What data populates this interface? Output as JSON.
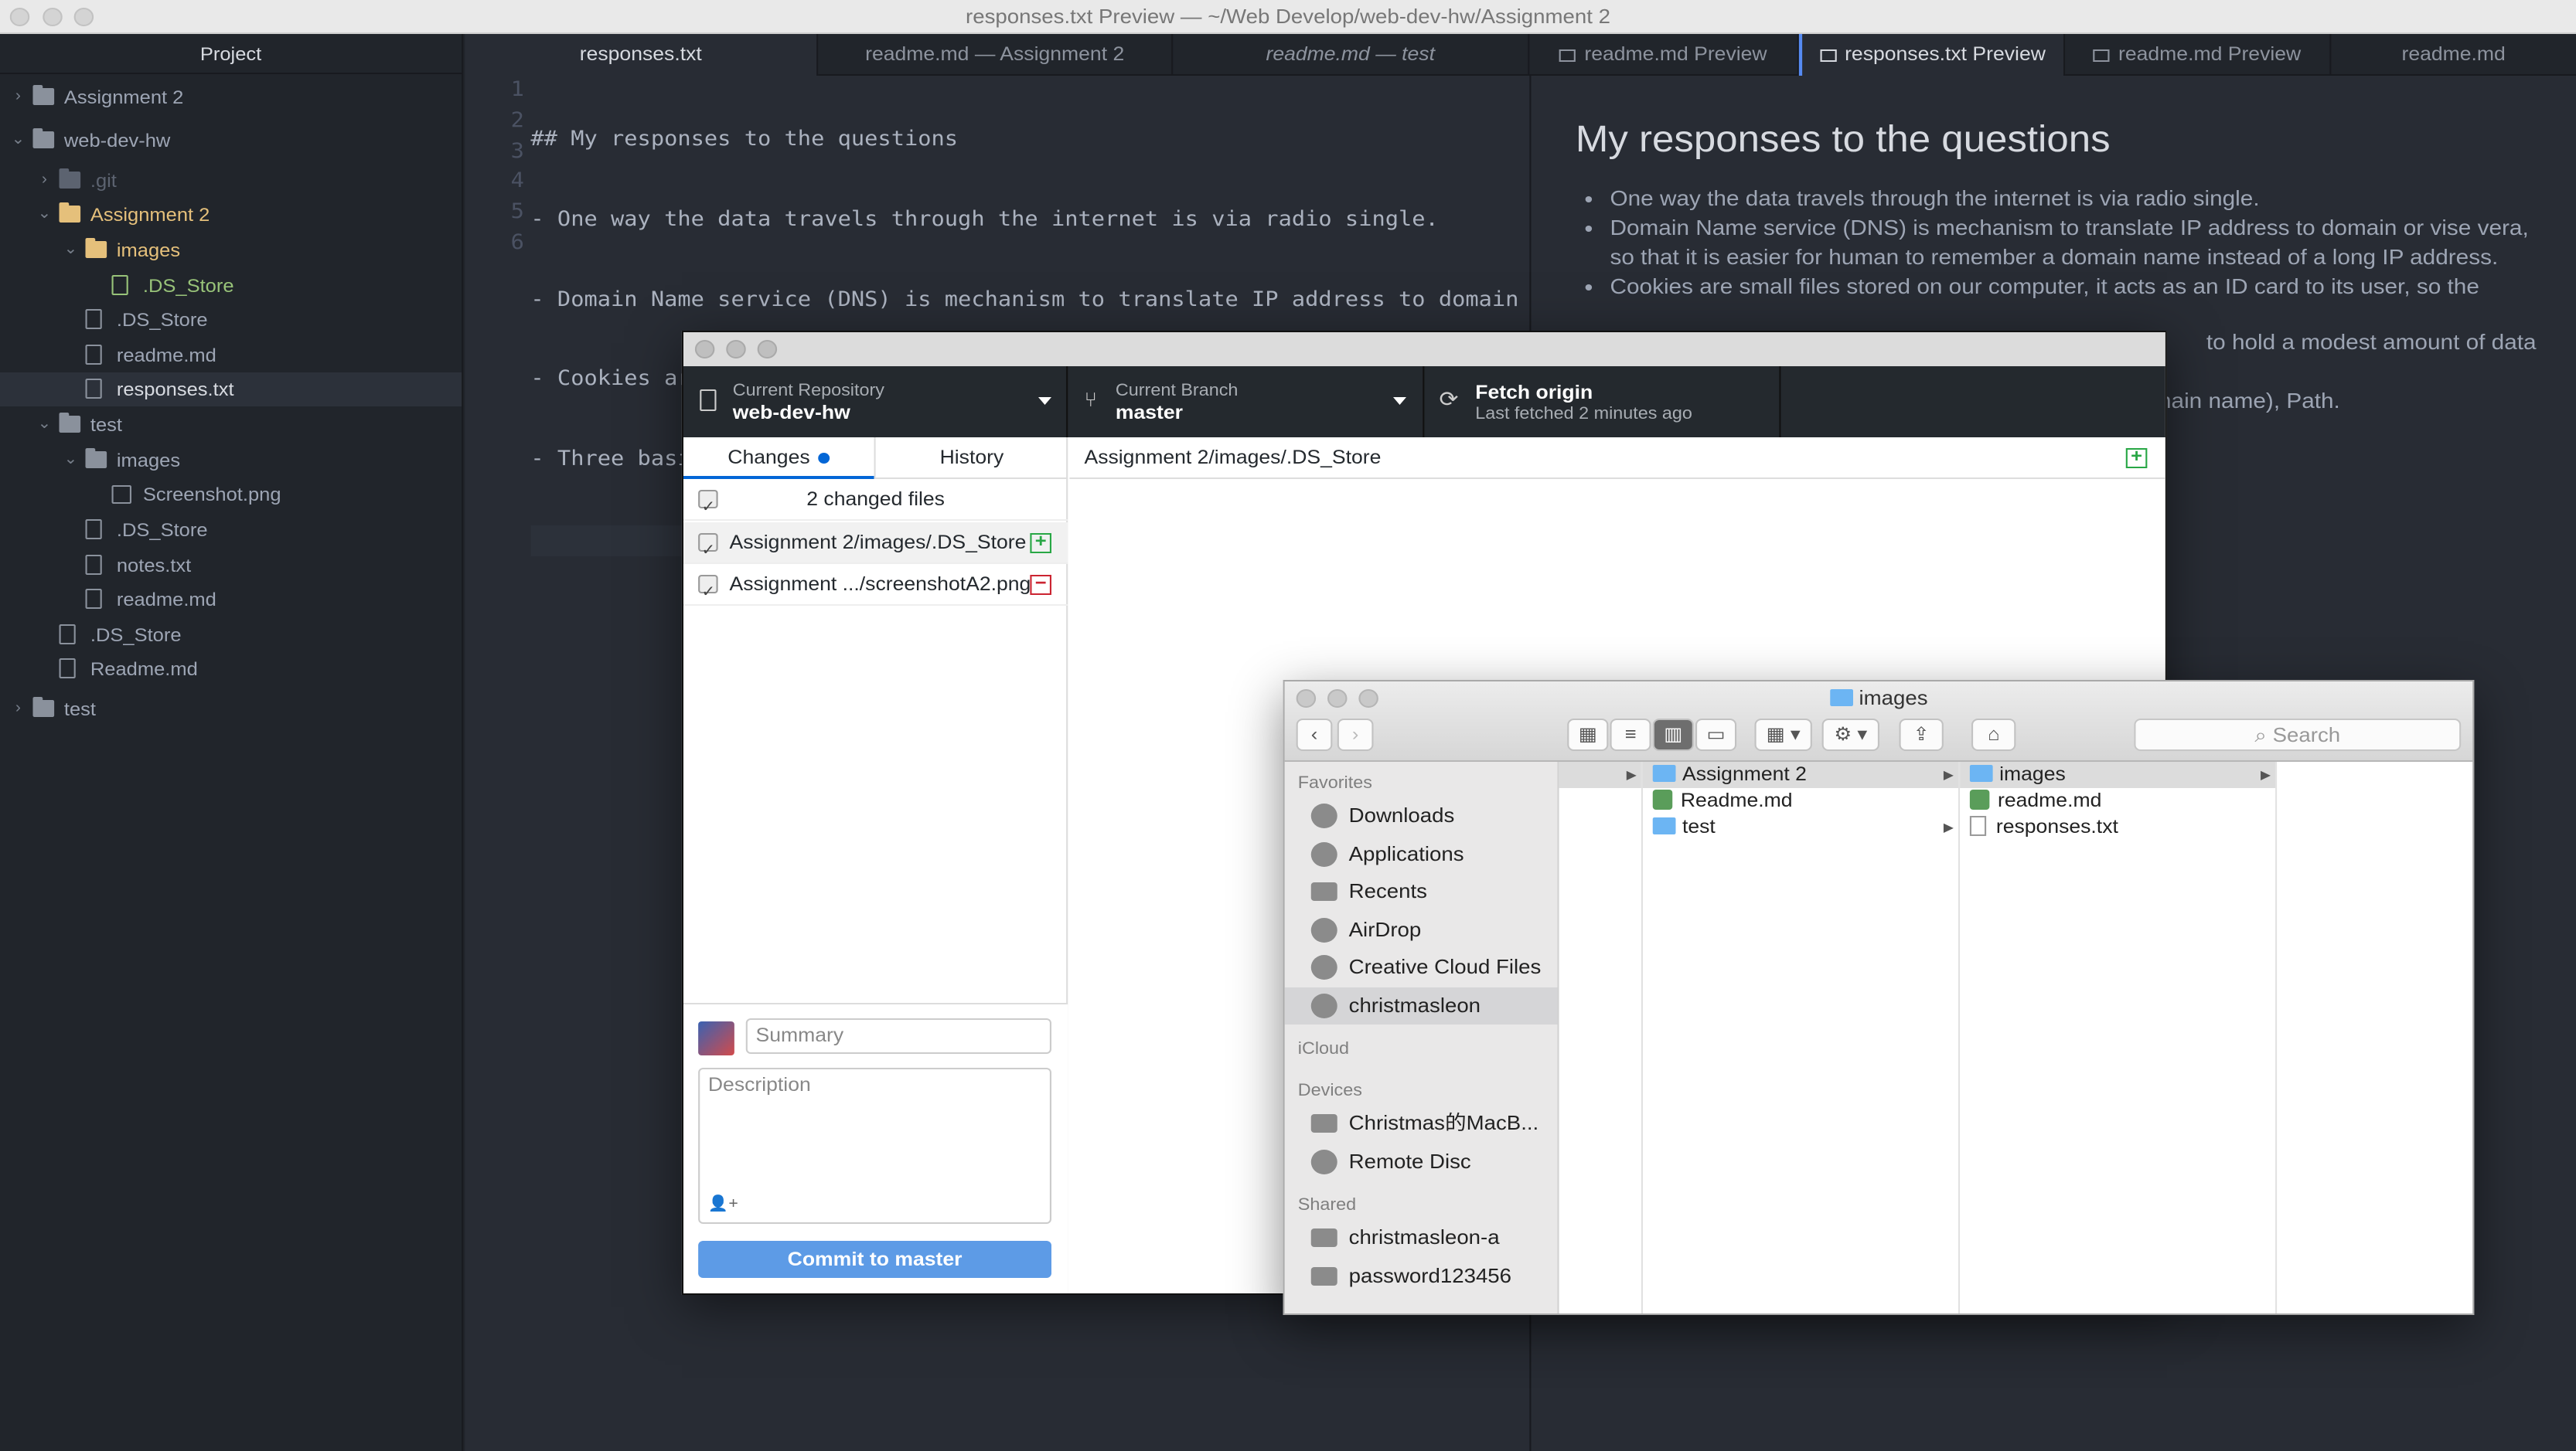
{
  "window": {
    "title": "responses.txt Preview — ~/Web Develop/web-dev-hw/Assignment 2"
  },
  "tree": {
    "header": "Project",
    "rows": [
      {
        "label": "Assignment 2",
        "type": "folder",
        "arrow": "›",
        "color": "#9da5b4"
      },
      {
        "label": "web-dev-hw",
        "type": "folder",
        "arrow": "⌄",
        "color": "#9da5b4"
      },
      {
        "label": ".git",
        "type": "folder",
        "arrow": "›",
        "color": "#5c6370"
      },
      {
        "label": "Assignment 2",
        "type": "folder",
        "arrow": "⌄",
        "color": "#e5c07b"
      },
      {
        "label": "images",
        "type": "folder",
        "arrow": "⌄",
        "color": "#e5c07b"
      },
      {
        "label": ".DS_Store",
        "type": "file",
        "arrow": "",
        "color": "#98c379"
      },
      {
        "label": ".DS_Store",
        "type": "file",
        "arrow": "",
        "color": "#9da5b4"
      },
      {
        "label": "readme.md",
        "type": "file",
        "arrow": "",
        "color": "#9da5b4"
      },
      {
        "label": "responses.txt",
        "type": "file",
        "arrow": "",
        "color": "#d7dae0"
      },
      {
        "label": "test",
        "type": "folder",
        "arrow": "⌄",
        "color": "#9da5b4"
      },
      {
        "label": "images",
        "type": "folder",
        "arrow": "⌄",
        "color": "#9da5b4"
      },
      {
        "label": "Screenshot.png",
        "type": "img",
        "arrow": "",
        "color": "#9da5b4"
      },
      {
        "label": ".DS_Store",
        "type": "file",
        "arrow": "",
        "color": "#9da5b4"
      },
      {
        "label": "notes.txt",
        "type": "file",
        "arrow": "",
        "color": "#9da5b4"
      },
      {
        "label": "readme.md",
        "type": "file",
        "arrow": "",
        "color": "#9da5b4"
      },
      {
        "label": ".DS_Store",
        "type": "file",
        "arrow": "",
        "color": "#9da5b4"
      },
      {
        "label": "Readme.md",
        "type": "file",
        "arrow": "",
        "color": "#9da5b4"
      },
      {
        "label": "test",
        "type": "folder",
        "arrow": "›",
        "color": "#9da5b4"
      }
    ]
  },
  "tabs": [
    {
      "label": "responses.txt"
    },
    {
      "label": "readme.md — Assignment 2"
    },
    {
      "label": "readme.md — test"
    },
    {
      "label": "readme.md Preview"
    },
    {
      "label": "responses.txt Preview"
    },
    {
      "label": "readme.md Preview"
    },
    {
      "label": "readme.md"
    }
  ],
  "editor": {
    "line_numbers": [
      "1",
      "2",
      "3",
      "4",
      "5",
      "6"
    ],
    "lines": [
      "## My responses to the questions",
      "- One way the data travels through the internet is via radio single.",
      "- Domain Name service (DNS) is mechanism to translate IP address to domain or vise vera, so that it is easier for human to remember a domain name instead of a long IP address.",
      "- Cookies are small files stored on our computer, it acts as an ID card to its user, so the",
      "- Three basic parts of a URL: Protocol, Server ID(Domain name), Path.",
      ""
    ]
  },
  "preview": {
    "heading": "My responses to the questions",
    "items": [
      "One way the data travels through the internet is via radio single.",
      "Domain Name service (DNS) is mechanism to translate IP address to domain or vise vera, so that it is easier for human to remember a domain name instead of a long IP address.",
      "Cookies are small files stored on our computer, it acts as an ID card to its user, so the",
      "to hold a modest amount of data",
      "main name), Path."
    ]
  },
  "github": {
    "repo_label": "Current Repository",
    "repo_value": "web-dev-hw",
    "branch_label": "Current Branch",
    "branch_value": "master",
    "fetch_title": "Fetch origin",
    "fetch_sub": "Last fetched 2 minutes ago",
    "tab_changes": "Changes",
    "tab_history": "History",
    "changed_count": "2 changed files",
    "files": [
      {
        "name": "Assignment 2/images/.DS_Store",
        "status": "added"
      },
      {
        "name": "Assignment .../screenshotA2.png",
        "status": "removed"
      }
    ],
    "diff_path": "Assignment 2/images/.DS_Store",
    "summary_placeholder": "Summary",
    "description_placeholder": "Description",
    "commit_button": "Commit to master",
    "colors": {
      "accent": "#0366d6",
      "add": "#28a745",
      "remove": "#cb2431",
      "button": "#5d9be6"
    }
  },
  "finder": {
    "title": "images",
    "search_placeholder": "Search",
    "favorites_header": "Favorites",
    "favorites": [
      {
        "label": "Downloads",
        "icon": "downloads-icon"
      },
      {
        "label": "Applications",
        "icon": "applications-icon"
      },
      {
        "label": "Recents",
        "icon": "recents-icon"
      },
      {
        "label": "AirDrop",
        "icon": "airdrop-icon"
      },
      {
        "label": "Creative Cloud Files",
        "icon": "creative-cloud-icon"
      },
      {
        "label": "christmasleon",
        "icon": "home-icon"
      }
    ],
    "icloud_header": "iCloud",
    "devices_header": "Devices",
    "devices": [
      {
        "label": "Christmas的MacB...",
        "icon": "laptop-icon"
      },
      {
        "label": "Remote Disc",
        "icon": "disc-icon"
      }
    ],
    "shared_header": "Shared",
    "shared": [
      {
        "label": "christmasleon-a",
        "icon": "monitor-icon"
      },
      {
        "label": "password123456",
        "icon": "monitor-icon"
      }
    ],
    "col1": [
      {
        "label": "Assignment 2",
        "kind": "folder",
        "arrow": true
      },
      {
        "label": "Readme.md",
        "kind": "md",
        "arrow": false
      },
      {
        "label": "test",
        "kind": "folder",
        "arrow": true
      }
    ],
    "col2": [
      {
        "label": "images",
        "kind": "folder",
        "arrow": true
      },
      {
        "label": "readme.md",
        "kind": "md",
        "arrow": false
      },
      {
        "label": "responses.txt",
        "kind": "doc",
        "arrow": false
      }
    ]
  }
}
